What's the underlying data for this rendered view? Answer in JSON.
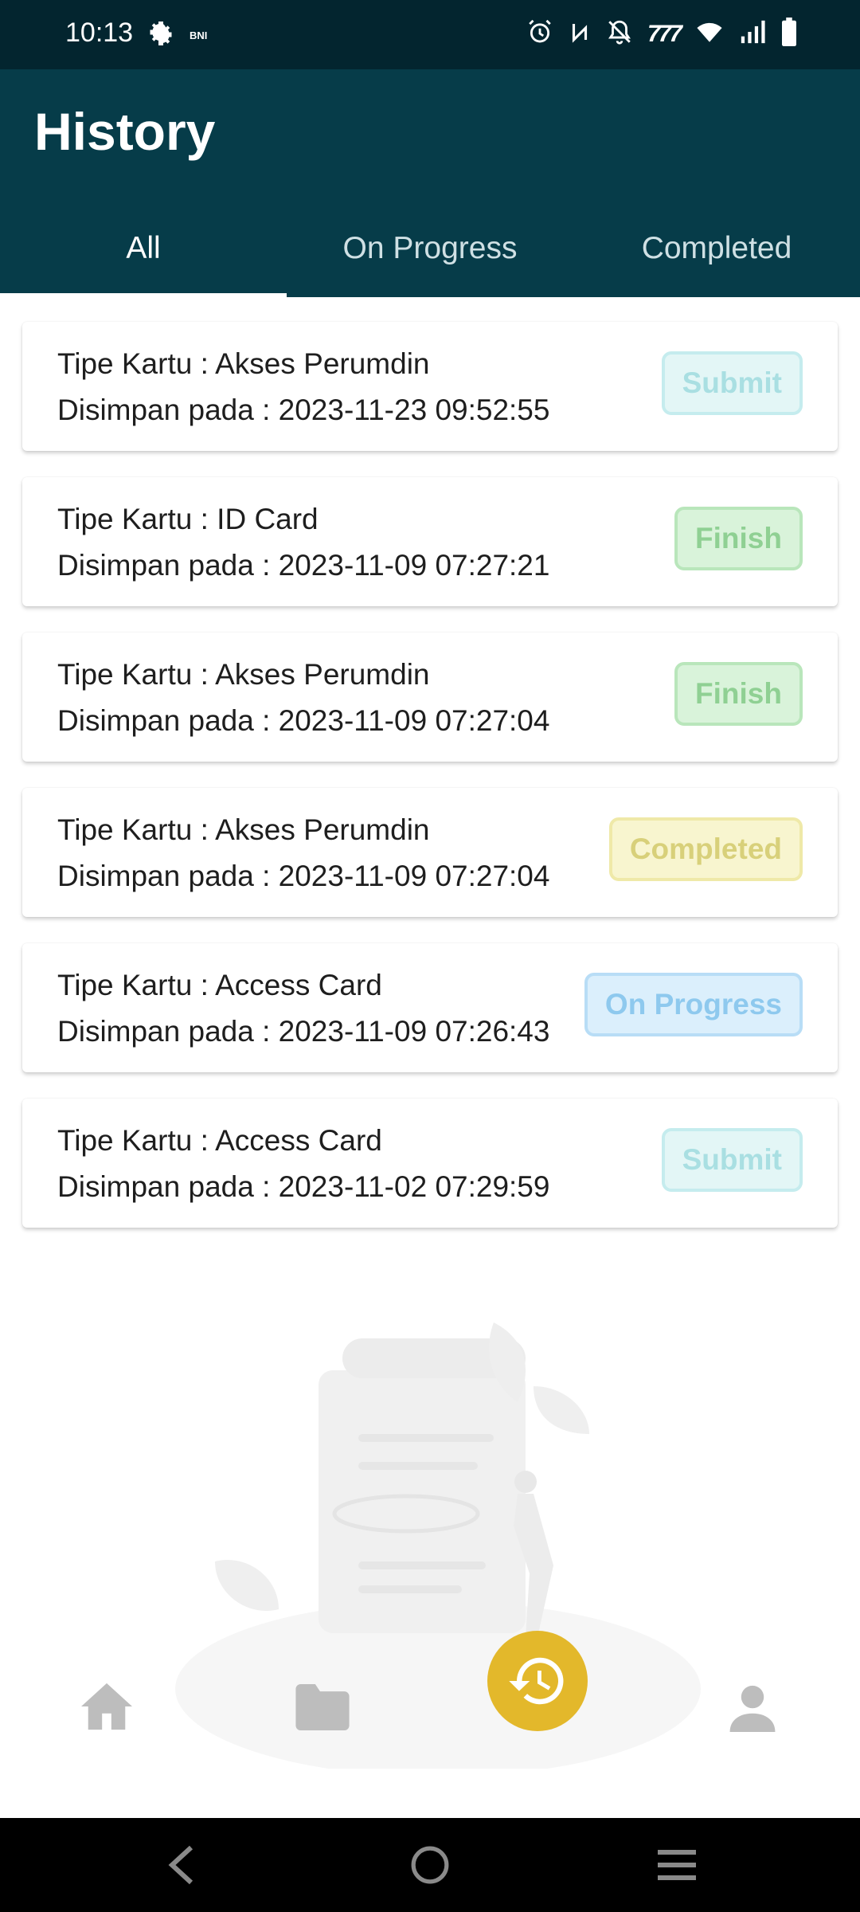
{
  "status_bar": {
    "time": "10:13",
    "bni_label": "BNI",
    "carrier_label": "777"
  },
  "header": {
    "title": "History",
    "tabs": [
      {
        "label": "All",
        "active": true
      },
      {
        "label": "On Progress",
        "active": false
      },
      {
        "label": "Completed",
        "active": false
      }
    ]
  },
  "history": {
    "items": [
      {
        "type_line": "Tipe Kartu : Akses Perumdin",
        "date_line": "Disimpan pada : 2023-11-23 09:52:55",
        "status": "Submit",
        "status_text_color": "#a9dfe2",
        "status_bg": "#e3f6f6",
        "status_border": "#c5ecee"
      },
      {
        "type_line": "Tipe Kartu : ID Card",
        "date_line": "Disimpan pada : 2023-11-09 07:27:21",
        "status": "Finish",
        "status_text_color": "#8fd093",
        "status_bg": "#d9f3da",
        "status_border": "#b9e6bb"
      },
      {
        "type_line": "Tipe Kartu : Akses Perumdin",
        "date_line": "Disimpan pada : 2023-11-09 07:27:04",
        "status": "Finish",
        "status_text_color": "#8fd093",
        "status_bg": "#d9f3da",
        "status_border": "#b9e6bb"
      },
      {
        "type_line": "Tipe Kartu : Akses Perumdin",
        "date_line": "Disimpan pada : 2023-11-09 07:27:04",
        "status": "Completed",
        "status_text_color": "#d8d07a",
        "status_bg": "#f8f5cf",
        "status_border": "#efe9a8"
      },
      {
        "type_line": "Tipe Kartu : Access Card",
        "date_line": "Disimpan pada : 2023-11-09 07:26:43",
        "status": "On Progress",
        "status_text_color": "#8ec9ee",
        "status_bg": "#dbeffc",
        "status_border": "#b8ddf6"
      },
      {
        "type_line": "Tipe Kartu : Access Card",
        "date_line": "Disimpan pada : 2023-11-02 07:29:59",
        "status": "Submit",
        "status_text_color": "#a9dfe2",
        "status_bg": "#e3f6f6",
        "status_border": "#c5ecee"
      }
    ]
  },
  "bottom_nav": {
    "items": [
      "home-icon",
      "folder-icon",
      "history-icon",
      "person-icon"
    ],
    "active_color": "#e3b82b",
    "inactive_color": "#bdbdbd"
  },
  "colors": {
    "header_bg": "#063c49",
    "status_bar_bg": "#03252f"
  }
}
